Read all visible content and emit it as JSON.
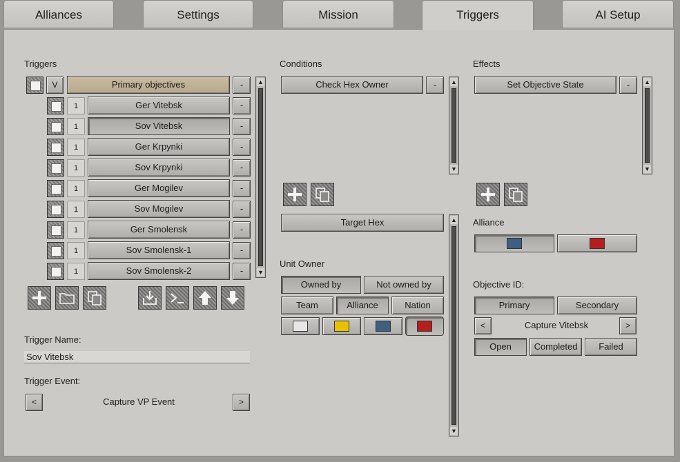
{
  "tabs": [
    {
      "label": "Alliances"
    },
    {
      "label": "Settings"
    },
    {
      "label": "Mission"
    },
    {
      "label": "Triggers"
    },
    {
      "label": "AI Setup"
    }
  ],
  "triggers": {
    "label": "Triggers",
    "header": {
      "toggle": "V",
      "name": "Primary objectives",
      "remove": "-"
    },
    "items": [
      {
        "count": "1",
        "name": "Ger Vitebsk",
        "remove": "-"
      },
      {
        "count": "1",
        "name": "Sov Vitebsk",
        "remove": "-"
      },
      {
        "count": "1",
        "name": "Ger Krpynki",
        "remove": "-"
      },
      {
        "count": "1",
        "name": "Sov Krpynki",
        "remove": "-"
      },
      {
        "count": "1",
        "name": "Ger Mogilev",
        "remove": "-"
      },
      {
        "count": "1",
        "name": "Sov Mogilev",
        "remove": "-"
      },
      {
        "count": "1",
        "name": "Ger Smolensk",
        "remove": "-"
      },
      {
        "count": "1",
        "name": "Sov Smolensk-1",
        "remove": "-"
      },
      {
        "count": "1",
        "name": "Sov Smolensk-2",
        "remove": "-"
      }
    ],
    "trigger_name_label": "Trigger Name:",
    "trigger_name_value": "Sov Vitebsk",
    "trigger_event_label": "Trigger Event:",
    "trigger_event_value": "Capture VP Event",
    "prev": "<",
    "next": ">"
  },
  "conditions": {
    "label": "Conditions",
    "items": [
      {
        "name": "Check Hex Owner",
        "remove": "-"
      }
    ],
    "target_hex": "Target Hex",
    "unit_owner_label": "Unit Owner",
    "owned_by": "Owned by",
    "not_owned_by": "Not owned by",
    "team": "Team",
    "alliance": "Alliance",
    "nation": "Nation",
    "colors": [
      "#e6e6e6",
      "#e8c200",
      "#3e5e82",
      "#b51e1e"
    ]
  },
  "effects": {
    "label": "Effects",
    "items": [
      {
        "name": "Set Objective State",
        "remove": "-"
      }
    ],
    "alliance_label": "Alliance",
    "alliance_colors": [
      "#3e5e82",
      "#b51e1e"
    ],
    "objective_id_label": "Objective ID:",
    "primary": "Primary",
    "secondary": "Secondary",
    "objective_value": "Capture Vitebsk",
    "prev": "<",
    "next": ">",
    "state_open": "Open",
    "state_completed": "Completed",
    "state_failed": "Failed"
  }
}
